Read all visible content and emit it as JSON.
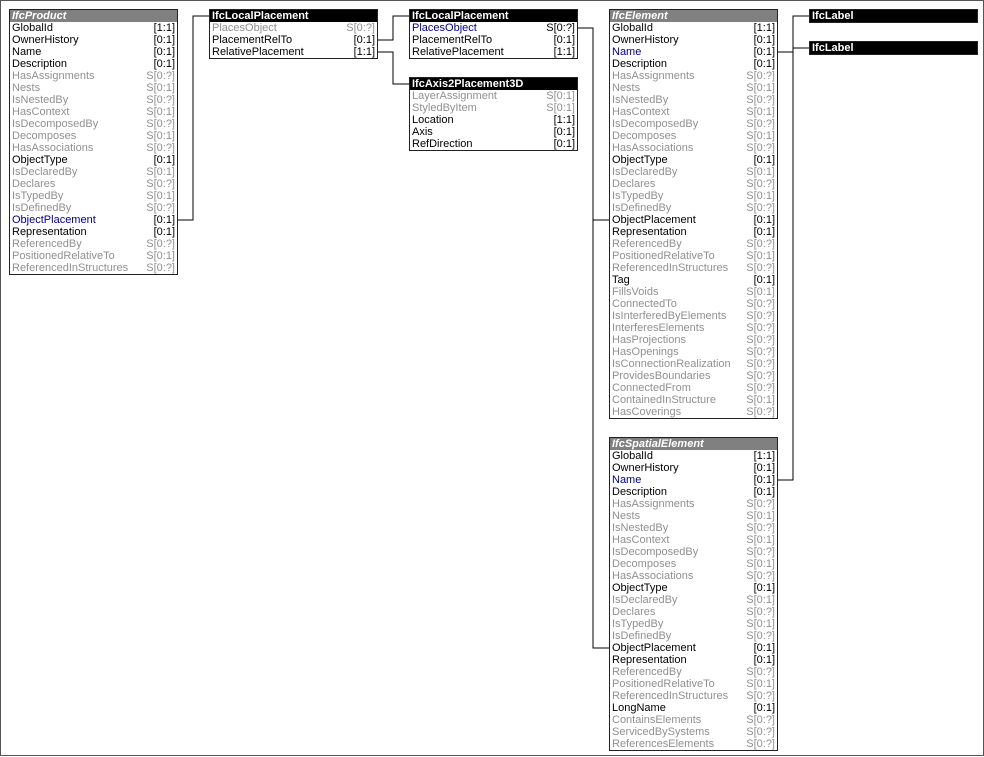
{
  "entities": [
    {
      "id": "ifcproduct",
      "title": "IfcProduct",
      "abstract": true,
      "attributes": [
        {
          "name": "GlobalId",
          "card": "[1:1]",
          "kind": "normal"
        },
        {
          "name": "OwnerHistory",
          "card": "[0:1]",
          "kind": "normal"
        },
        {
          "name": "Name",
          "card": "[0:1]",
          "kind": "normal"
        },
        {
          "name": "Description",
          "card": "[0:1]",
          "kind": "normal"
        },
        {
          "name": "HasAssignments",
          "card": "S[0:?]",
          "kind": "inverse"
        },
        {
          "name": "Nests",
          "card": "S[0:1]",
          "kind": "inverse"
        },
        {
          "name": "IsNestedBy",
          "card": "S[0:?]",
          "kind": "inverse"
        },
        {
          "name": "HasContext",
          "card": "S[0:1]",
          "kind": "inverse"
        },
        {
          "name": "IsDecomposedBy",
          "card": "S[0:?]",
          "kind": "inverse"
        },
        {
          "name": "Decomposes",
          "card": "S[0:1]",
          "kind": "inverse"
        },
        {
          "name": "HasAssociations",
          "card": "S[0:?]",
          "kind": "inverse"
        },
        {
          "name": "ObjectType",
          "card": "[0:1]",
          "kind": "normal"
        },
        {
          "name": "IsDeclaredBy",
          "card": "S[0:1]",
          "kind": "inverse"
        },
        {
          "name": "Declares",
          "card": "S[0:?]",
          "kind": "inverse"
        },
        {
          "name": "IsTypedBy",
          "card": "S[0:1]",
          "kind": "inverse"
        },
        {
          "name": "IsDefinedBy",
          "card": "S[0:?]",
          "kind": "inverse"
        },
        {
          "name": "ObjectPlacement",
          "card": "[0:1]",
          "kind": "hl"
        },
        {
          "name": "Representation",
          "card": "[0:1]",
          "kind": "normal"
        },
        {
          "name": "ReferencedBy",
          "card": "S[0:?]",
          "kind": "inverse"
        },
        {
          "name": "PositionedRelativeTo",
          "card": "S[0:1]",
          "kind": "inverse"
        },
        {
          "name": "ReferencedInStructures",
          "card": "S[0:?]",
          "kind": "inverse"
        }
      ]
    },
    {
      "id": "ifclocalplacement-1",
      "title": "IfcLocalPlacement",
      "abstract": false,
      "attributes": [
        {
          "name": "PlacesObject",
          "card": "S[0:?]",
          "kind": "inverse"
        },
        {
          "name": "PlacementRelTo",
          "card": "[0:1]",
          "kind": "normal"
        },
        {
          "name": "RelativePlacement",
          "card": "[1:1]",
          "kind": "normal"
        }
      ]
    },
    {
      "id": "ifclocalplacement-2",
      "title": "IfcLocalPlacement",
      "abstract": false,
      "attributes": [
        {
          "name": "PlacesObject",
          "card": "S[0:?]",
          "kind": "hl"
        },
        {
          "name": "PlacementRelTo",
          "card": "[0:1]",
          "kind": "normal"
        },
        {
          "name": "RelativePlacement",
          "card": "[1:1]",
          "kind": "normal"
        }
      ]
    },
    {
      "id": "ifcaxis2placement3d",
      "title": "IfcAxis2Placement3D",
      "abstract": false,
      "attributes": [
        {
          "name": "LayerAssignment",
          "card": "S[0:1]",
          "kind": "inverse"
        },
        {
          "name": "StyledByItem",
          "card": "S[0:1]",
          "kind": "inverse"
        },
        {
          "name": "Location",
          "card": "[1:1]",
          "kind": "normal"
        },
        {
          "name": "Axis",
          "card": "[0:1]",
          "kind": "normal"
        },
        {
          "name": "RefDirection",
          "card": "[0:1]",
          "kind": "normal"
        }
      ]
    },
    {
      "id": "ifcelement",
      "title": "IfcElement",
      "abstract": true,
      "attributes": [
        {
          "name": "GlobalId",
          "card": "[1:1]",
          "kind": "normal"
        },
        {
          "name": "OwnerHistory",
          "card": "[0:1]",
          "kind": "normal"
        },
        {
          "name": "Name",
          "card": "[0:1]",
          "kind": "hl"
        },
        {
          "name": "Description",
          "card": "[0:1]",
          "kind": "normal"
        },
        {
          "name": "HasAssignments",
          "card": "S[0:?]",
          "kind": "inverse"
        },
        {
          "name": "Nests",
          "card": "S[0:1]",
          "kind": "inverse"
        },
        {
          "name": "IsNestedBy",
          "card": "S[0:?]",
          "kind": "inverse"
        },
        {
          "name": "HasContext",
          "card": "S[0:1]",
          "kind": "inverse"
        },
        {
          "name": "IsDecomposedBy",
          "card": "S[0:?]",
          "kind": "inverse"
        },
        {
          "name": "Decomposes",
          "card": "S[0:1]",
          "kind": "inverse"
        },
        {
          "name": "HasAssociations",
          "card": "S[0:?]",
          "kind": "inverse"
        },
        {
          "name": "ObjectType",
          "card": "[0:1]",
          "kind": "normal"
        },
        {
          "name": "IsDeclaredBy",
          "card": "S[0:1]",
          "kind": "inverse"
        },
        {
          "name": "Declares",
          "card": "S[0:?]",
          "kind": "inverse"
        },
        {
          "name": "IsTypedBy",
          "card": "S[0:1]",
          "kind": "inverse"
        },
        {
          "name": "IsDefinedBy",
          "card": "S[0:?]",
          "kind": "inverse"
        },
        {
          "name": "ObjectPlacement",
          "card": "[0:1]",
          "kind": "normal"
        },
        {
          "name": "Representation",
          "card": "[0:1]",
          "kind": "normal"
        },
        {
          "name": "ReferencedBy",
          "card": "S[0:?]",
          "kind": "inverse"
        },
        {
          "name": "PositionedRelativeTo",
          "card": "S[0:1]",
          "kind": "inverse"
        },
        {
          "name": "ReferencedInStructures",
          "card": "S[0:?]",
          "kind": "inverse"
        },
        {
          "name": "Tag",
          "card": "[0:1]",
          "kind": "normal"
        },
        {
          "name": "FillsVoids",
          "card": "S[0:1]",
          "kind": "inverse"
        },
        {
          "name": "ConnectedTo",
          "card": "S[0:?]",
          "kind": "inverse"
        },
        {
          "name": "IsInterferedByElements",
          "card": "S[0:?]",
          "kind": "inverse"
        },
        {
          "name": "InterferesElements",
          "card": "S[0:?]",
          "kind": "inverse"
        },
        {
          "name": "HasProjections",
          "card": "S[0:?]",
          "kind": "inverse"
        },
        {
          "name": "HasOpenings",
          "card": "S[0:?]",
          "kind": "inverse"
        },
        {
          "name": "IsConnectionRealization",
          "card": "S[0:?]",
          "kind": "inverse"
        },
        {
          "name": "ProvidesBoundaries",
          "card": "S[0:?]",
          "kind": "inverse"
        },
        {
          "name": "ConnectedFrom",
          "card": "S[0:?]",
          "kind": "inverse"
        },
        {
          "name": "ContainedInStructure",
          "card": "S[0:1]",
          "kind": "inverse"
        },
        {
          "name": "HasCoverings",
          "card": "S[0:?]",
          "kind": "inverse"
        }
      ]
    },
    {
      "id": "ifcspatialelement",
      "title": "IfcSpatialElement",
      "abstract": true,
      "attributes": [
        {
          "name": "GlobalId",
          "card": "[1:1]",
          "kind": "normal"
        },
        {
          "name": "OwnerHistory",
          "card": "[0:1]",
          "kind": "normal"
        },
        {
          "name": "Name",
          "card": "[0:1]",
          "kind": "hl"
        },
        {
          "name": "Description",
          "card": "[0:1]",
          "kind": "normal"
        },
        {
          "name": "HasAssignments",
          "card": "S[0:?]",
          "kind": "inverse"
        },
        {
          "name": "Nests",
          "card": "S[0:1]",
          "kind": "inverse"
        },
        {
          "name": "IsNestedBy",
          "card": "S[0:?]",
          "kind": "inverse"
        },
        {
          "name": "HasContext",
          "card": "S[0:1]",
          "kind": "inverse"
        },
        {
          "name": "IsDecomposedBy",
          "card": "S[0:?]",
          "kind": "inverse"
        },
        {
          "name": "Decomposes",
          "card": "S[0:1]",
          "kind": "inverse"
        },
        {
          "name": "HasAssociations",
          "card": "S[0:?]",
          "kind": "inverse"
        },
        {
          "name": "ObjectType",
          "card": "[0:1]",
          "kind": "normal"
        },
        {
          "name": "IsDeclaredBy",
          "card": "S[0:1]",
          "kind": "inverse"
        },
        {
          "name": "Declares",
          "card": "S[0:?]",
          "kind": "inverse"
        },
        {
          "name": "IsTypedBy",
          "card": "S[0:1]",
          "kind": "inverse"
        },
        {
          "name": "IsDefinedBy",
          "card": "S[0:?]",
          "kind": "inverse"
        },
        {
          "name": "ObjectPlacement",
          "card": "[0:1]",
          "kind": "normal"
        },
        {
          "name": "Representation",
          "card": "[0:1]",
          "kind": "normal"
        },
        {
          "name": "ReferencedBy",
          "card": "S[0:?]",
          "kind": "inverse"
        },
        {
          "name": "PositionedRelativeTo",
          "card": "S[0:1]",
          "kind": "inverse"
        },
        {
          "name": "ReferencedInStructures",
          "card": "S[0:?]",
          "kind": "inverse"
        },
        {
          "name": "LongName",
          "card": "[0:1]",
          "kind": "normal"
        },
        {
          "name": "ContainsElements",
          "card": "S[0:?]",
          "kind": "inverse"
        },
        {
          "name": "ServicedBySystems",
          "card": "S[0:?]",
          "kind": "inverse"
        },
        {
          "name": "ReferencesElements",
          "card": "S[0:?]",
          "kind": "inverse"
        }
      ]
    },
    {
      "id": "ifclabel-1",
      "title": "IfcLabel",
      "abstract": false,
      "attributes": []
    },
    {
      "id": "ifclabel-2",
      "title": "IfcLabel",
      "abstract": false,
      "attributes": []
    }
  ],
  "colors": {
    "concrete_header": "#000000",
    "abstract_header": "#808080",
    "inverse_text": "#909090",
    "highlight_text": "#00008b",
    "line": "#000000"
  }
}
